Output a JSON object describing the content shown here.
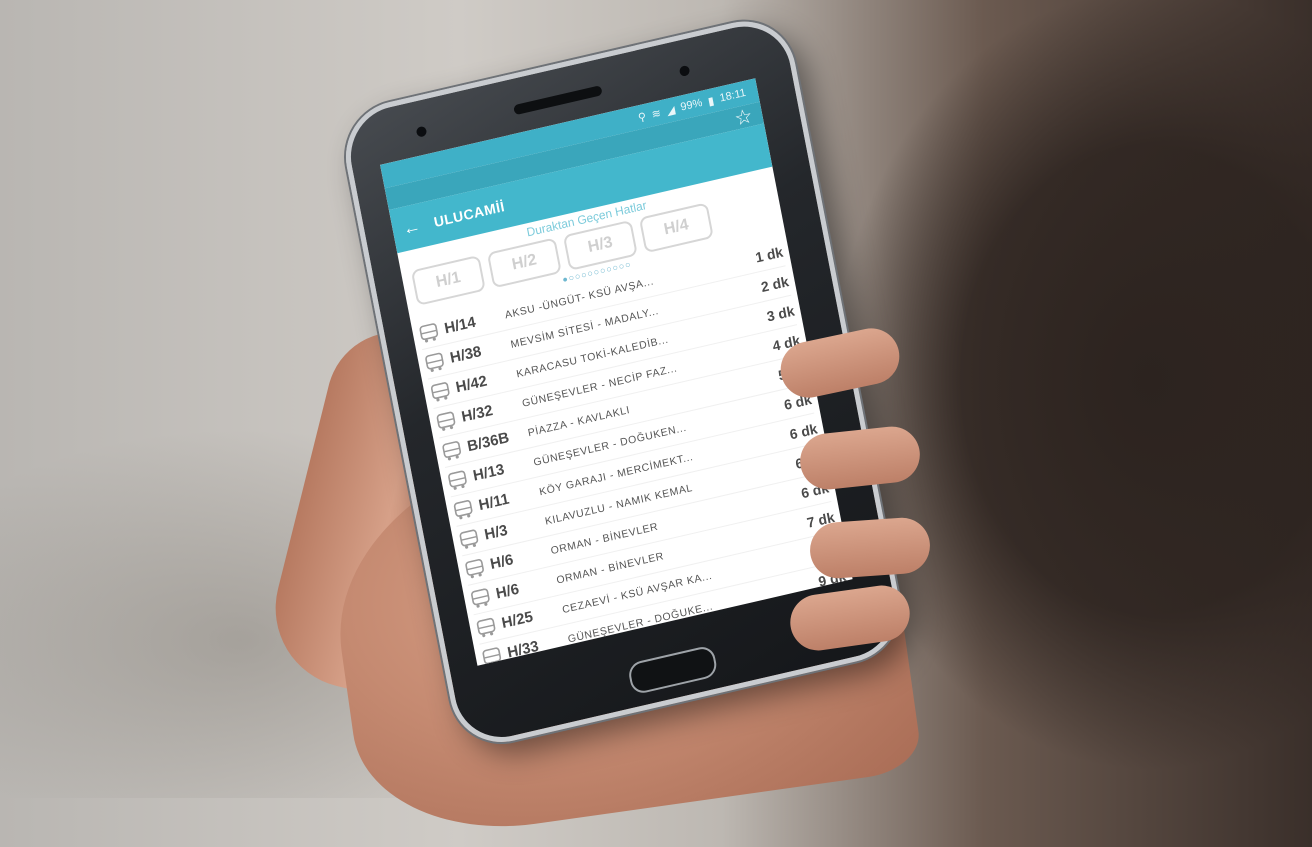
{
  "statusbar": {
    "icons": [
      "location-icon",
      "wifi-icon",
      "signal-icon",
      "battery-icon"
    ],
    "battery": "99%",
    "time": "18:11"
  },
  "appbar": {
    "title": "ULUCAMİİ",
    "back_icon": "back-arrow-icon",
    "favorite_icon": "star-icon"
  },
  "lines_section": {
    "label": "Duraktan Geçen Hatlar",
    "chips": [
      "H/1",
      "H/2",
      "H/3",
      "H/4"
    ],
    "pager_dots": "●○○○○○○○○○○"
  },
  "arrivals": [
    {
      "code": "H/14",
      "route": "AKSU -ÜNGÜT- KSÜ AVŞA...",
      "eta": "1 dk"
    },
    {
      "code": "H/38",
      "route": "MEVSİM SİTESİ - MADALY...",
      "eta": "2 dk"
    },
    {
      "code": "H/42",
      "route": "KARACASU TOKİ-KALEDİB...",
      "eta": "3 dk"
    },
    {
      "code": "H/32",
      "route": "GÜNEŞEVLER - NECİP FAZ...",
      "eta": "4 dk"
    },
    {
      "code": "B/36B",
      "route": "PİAZZA - KAVLAKLI",
      "eta": "5 dk"
    },
    {
      "code": "H/13",
      "route": "GÜNEŞEVLER - DOĞUKEN...",
      "eta": "6 dk"
    },
    {
      "code": "H/11",
      "route": "KÖY GARAJI - MERCİMEKT...",
      "eta": "6 dk"
    },
    {
      "code": "H/3",
      "route": "KILAVUZLU - NAMIK KEMAL",
      "eta": "6 dk"
    },
    {
      "code": "H/6",
      "route": "ORMAN - BİNEVLER",
      "eta": "6 dk"
    },
    {
      "code": "H/6",
      "route": "ORMAN - BİNEVLER",
      "eta": "7 dk"
    },
    {
      "code": "H/25",
      "route": "CEZAEVİ - KSÜ AVŞAR KA...",
      "eta": "8 dk"
    },
    {
      "code": "H/33",
      "route": "GÜNEŞEVLER - DOĞUKE...",
      "eta": "9 dk"
    }
  ],
  "colors": {
    "accent": "#43b7cc",
    "statusbar": "#3fb0c7",
    "chip_border": "#d6d6d6",
    "text": "#4a4a4a"
  }
}
